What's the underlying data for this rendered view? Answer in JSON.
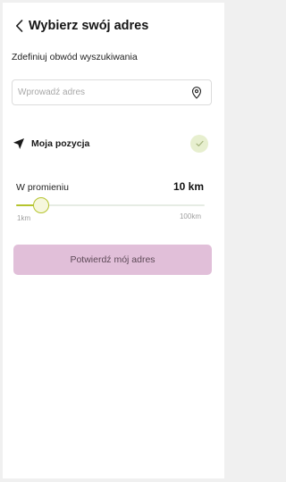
{
  "header": {
    "title": "Wybierz swój adres"
  },
  "subtitle": "Zdefiniuj obwód wyszukiwania",
  "address": {
    "placeholder": "Wprowadź adres",
    "value": ""
  },
  "my_position": {
    "label": "Moja pozycja",
    "selected": true
  },
  "radius": {
    "label": "W promieniu",
    "value_text": "10 km",
    "min_label": "1km",
    "max_label": "100km",
    "min": 1,
    "max": 100,
    "value": 10
  },
  "confirm_button": {
    "label": "Potwierdź mój adres"
  },
  "colors": {
    "accent": "#b5c42e",
    "check_badge": "#e7efcf",
    "button_bg": "#e1bfd9",
    "button_text": "#5e4a58"
  }
}
